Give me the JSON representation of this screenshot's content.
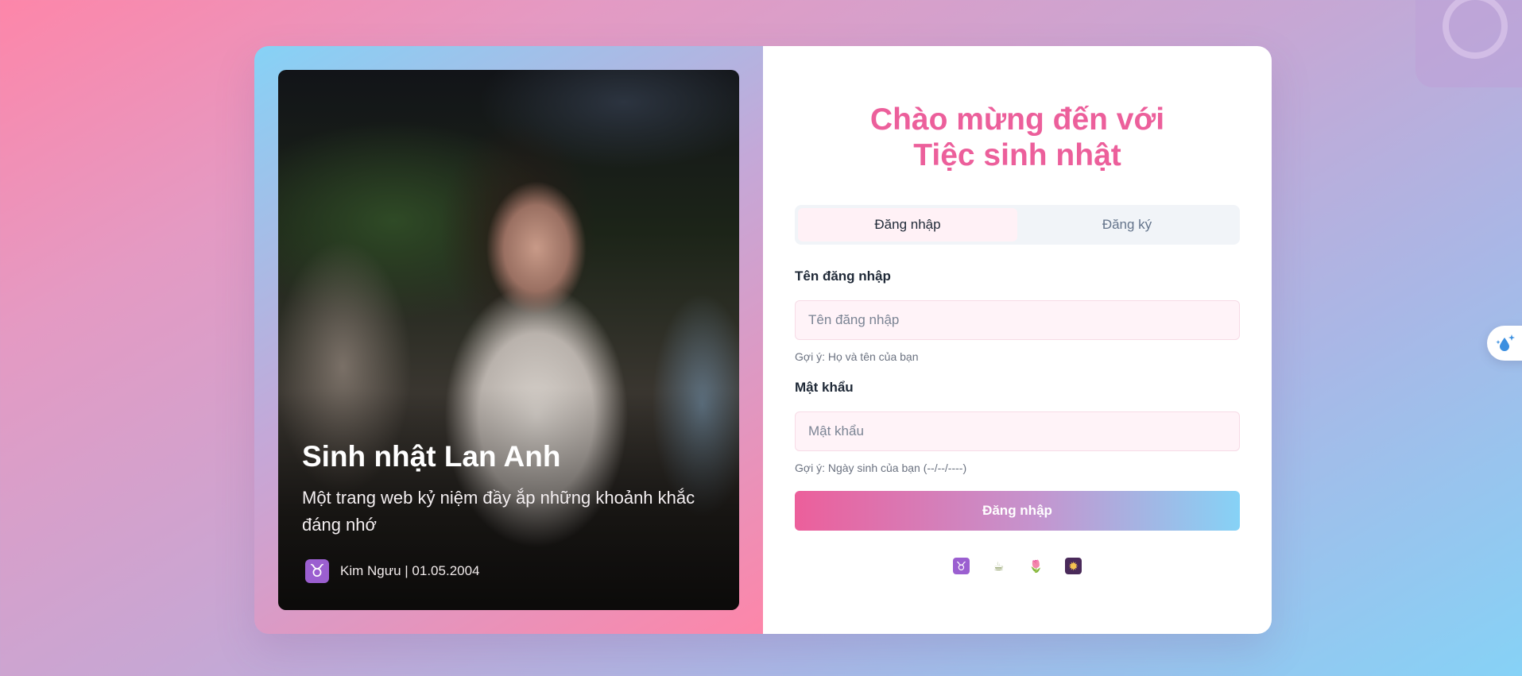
{
  "welcome": {
    "line1": "Chào mừng đến với",
    "line2": "Tiệc sinh nhật"
  },
  "tabs": [
    {
      "label": "Đăng nhập",
      "active": true
    },
    {
      "label": "Đăng ký",
      "active": false
    }
  ],
  "form": {
    "username": {
      "label": "Tên đăng nhập",
      "placeholder": "Tên đăng nhập",
      "value": "",
      "hint": "Gợi ý: Họ và tên của bạn"
    },
    "password": {
      "label": "Mật khẩu",
      "placeholder": "Mật khẩu",
      "value": "",
      "hint": "Gợi ý: Ngày sinh của bạn (--/--/----)"
    },
    "submit_label": "Đăng nhập"
  },
  "hero": {
    "title": "Sinh nhật Lan Anh",
    "subtitle": "Một trang web kỷ niệm đầy ắp những khoảnh khắc đáng nhớ",
    "zodiac_icon": "♉",
    "meta": "Kim Ngưu | 01.05.2004"
  },
  "icons": [
    {
      "name": "taurus-icon",
      "glyph": "♉",
      "bg": "#9b5fd0",
      "color": "#ffffff"
    },
    {
      "name": "tea-icon",
      "glyph": "☕",
      "bg": "#ffffff",
      "color": "#7a8c4a"
    },
    {
      "name": "tulip-icon",
      "glyph": "🌷",
      "bg": "#ffffff",
      "color": "#e0458a"
    },
    {
      "name": "sparkle-icon",
      "glyph": "✹",
      "bg": "#4a2a5a",
      "color": "#f5c451"
    }
  ],
  "floating_button_icon": "droplet-sparkle-icon",
  "colors": {
    "accent_pink": "#ec5f9b",
    "accent_blue": "#86d2f6",
    "background_pink": "#fd86a9"
  }
}
